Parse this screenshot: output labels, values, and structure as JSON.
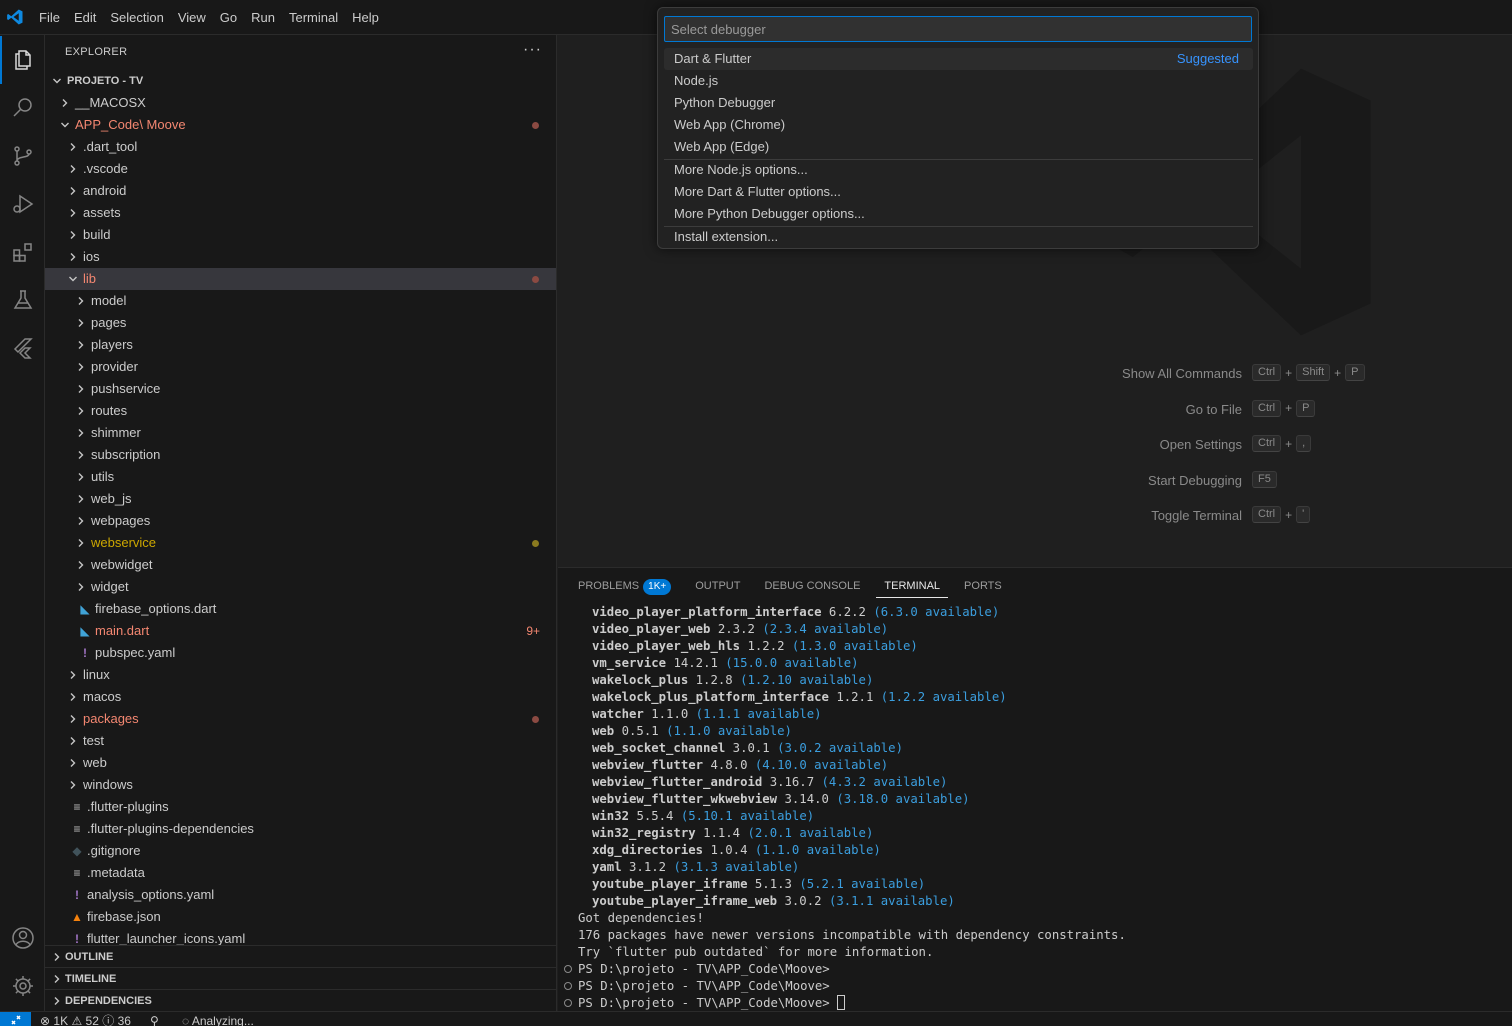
{
  "menubar": [
    "File",
    "Edit",
    "Selection",
    "View",
    "Go",
    "Run",
    "Terminal",
    "Help"
  ],
  "activity": [
    "explorer-icon",
    "search-icon",
    "source-control-icon",
    "run-debug-icon",
    "extensions-icon",
    "testing-icon",
    "flutter-icon",
    "accounts-icon",
    "settings-gear-icon"
  ],
  "sidebar": {
    "title": "EXPLORER",
    "more": "···",
    "tree": [
      {
        "indent": 0,
        "kind": "root",
        "open": true,
        "label": "PROJETO - TV"
      },
      {
        "indent": 1,
        "kind": "folder",
        "open": false,
        "label": "__MACOSX"
      },
      {
        "indent": 1,
        "kind": "folder",
        "open": true,
        "label": "APP_Code\\ Moove",
        "color": "#f48771",
        "dot": "#8b4a42"
      },
      {
        "indent": 2,
        "kind": "folder",
        "open": false,
        "label": ".dart_tool"
      },
      {
        "indent": 2,
        "kind": "folder",
        "open": false,
        "label": ".vscode"
      },
      {
        "indent": 2,
        "kind": "folder",
        "open": false,
        "label": "android"
      },
      {
        "indent": 2,
        "kind": "folder",
        "open": false,
        "label": "assets"
      },
      {
        "indent": 2,
        "kind": "folder",
        "open": false,
        "label": "build"
      },
      {
        "indent": 2,
        "kind": "folder",
        "open": false,
        "label": "ios"
      },
      {
        "indent": 2,
        "kind": "folder",
        "open": true,
        "label": "lib",
        "color": "#f48771",
        "dot": "#8b4a42",
        "selected": true
      },
      {
        "indent": 3,
        "kind": "folder",
        "open": false,
        "label": "model"
      },
      {
        "indent": 3,
        "kind": "folder",
        "open": false,
        "label": "pages"
      },
      {
        "indent": 3,
        "kind": "folder",
        "open": false,
        "label": "players"
      },
      {
        "indent": 3,
        "kind": "folder",
        "open": false,
        "label": "provider"
      },
      {
        "indent": 3,
        "kind": "folder",
        "open": false,
        "label": "pushservice"
      },
      {
        "indent": 3,
        "kind": "folder",
        "open": false,
        "label": "routes"
      },
      {
        "indent": 3,
        "kind": "folder",
        "open": false,
        "label": "shimmer"
      },
      {
        "indent": 3,
        "kind": "folder",
        "open": false,
        "label": "subscription"
      },
      {
        "indent": 3,
        "kind": "folder",
        "open": false,
        "label": "utils"
      },
      {
        "indent": 3,
        "kind": "folder",
        "open": false,
        "label": "web_js"
      },
      {
        "indent": 3,
        "kind": "folder",
        "open": false,
        "label": "webpages"
      },
      {
        "indent": 3,
        "kind": "folder",
        "open": false,
        "label": "webservice",
        "color": "#cca700",
        "dot": "#8a7a1f"
      },
      {
        "indent": 3,
        "kind": "folder",
        "open": false,
        "label": "webwidget"
      },
      {
        "indent": 3,
        "kind": "folder",
        "open": false,
        "label": "widget"
      },
      {
        "indent": 3,
        "kind": "file",
        "icon": "dart-file-icon",
        "glyph": "◣",
        "glyphColor": "#40a3d7",
        "label": "firebase_options.dart"
      },
      {
        "indent": 3,
        "kind": "file",
        "icon": "dart-file-icon",
        "glyph": "◣",
        "glyphColor": "#40a3d7",
        "label": "main.dart",
        "color": "#f48771",
        "badge": "9+"
      },
      {
        "indent": 3,
        "kind": "file",
        "icon": "yaml-file-icon",
        "glyph": "!",
        "glyphColor": "#a074c4",
        "label": "pubspec.yaml"
      },
      {
        "indent": 2,
        "kind": "folder",
        "open": false,
        "label": "linux"
      },
      {
        "indent": 2,
        "kind": "folder",
        "open": false,
        "label": "macos"
      },
      {
        "indent": 2,
        "kind": "folder",
        "open": false,
        "label": "packages",
        "color": "#f48771",
        "dot": "#8b4a42"
      },
      {
        "indent": 2,
        "kind": "folder",
        "open": false,
        "label": "test"
      },
      {
        "indent": 2,
        "kind": "folder",
        "open": false,
        "label": "web"
      },
      {
        "indent": 2,
        "kind": "folder",
        "open": false,
        "label": "windows"
      },
      {
        "indent": 2,
        "kind": "file",
        "icon": "text-file-icon",
        "glyph": "≡",
        "glyphColor": "#bbbbbb",
        "label": ".flutter-plugins"
      },
      {
        "indent": 2,
        "kind": "file",
        "icon": "text-file-icon",
        "glyph": "≡",
        "glyphColor": "#bbbbbb",
        "label": ".flutter-plugins-dependencies"
      },
      {
        "indent": 2,
        "kind": "file",
        "icon": "git-file-icon",
        "glyph": "◆",
        "glyphColor": "#41535b",
        "label": ".gitignore"
      },
      {
        "indent": 2,
        "kind": "file",
        "icon": "text-file-icon",
        "glyph": "≡",
        "glyphColor": "#bbbbbb",
        "label": ".metadata"
      },
      {
        "indent": 2,
        "kind": "file",
        "icon": "yaml-file-icon",
        "glyph": "!",
        "glyphColor": "#a074c4",
        "label": "analysis_options.yaml"
      },
      {
        "indent": 2,
        "kind": "file",
        "icon": "firebase-file-icon",
        "glyph": "▲",
        "glyphColor": "#f5820d",
        "label": "firebase.json"
      },
      {
        "indent": 2,
        "kind": "file",
        "icon": "yaml-file-icon",
        "glyph": "!",
        "glyphColor": "#a074c4",
        "label": "flutter_launcher_icons.yaml"
      }
    ],
    "sections": [
      "OUTLINE",
      "TIMELINE",
      "DEPENDENCIES"
    ]
  },
  "quickpick": {
    "placeholder": "Select debugger",
    "items": [
      {
        "label": "Dart & Flutter",
        "detail": "Suggested",
        "active": true
      },
      {
        "label": "Node.js"
      },
      {
        "label": "Python Debugger"
      },
      {
        "label": "Web App (Chrome)"
      },
      {
        "label": "Web App (Edge)",
        "sepAfter": true
      },
      {
        "label": "More Node.js options..."
      },
      {
        "label": "More Dart & Flutter options..."
      },
      {
        "label": "More Python Debugger options...",
        "sepAfter": true
      },
      {
        "label": "Install extension..."
      }
    ]
  },
  "editor": {
    "shortcuts": [
      {
        "label": "Show All Commands",
        "keys": [
          "Ctrl",
          "Shift",
          "P"
        ]
      },
      {
        "label": "Go to File",
        "keys": [
          "Ctrl",
          "P"
        ]
      },
      {
        "label": "Open Settings",
        "keys": [
          "Ctrl",
          ","
        ]
      },
      {
        "label": "Start Debugging",
        "keys": [
          "F5"
        ]
      },
      {
        "label": "Toggle Terminal",
        "keys": [
          "Ctrl",
          "'"
        ]
      }
    ]
  },
  "panel": {
    "tabs": [
      {
        "label": "PROBLEMS",
        "badge": "1K+"
      },
      {
        "label": "OUTPUT"
      },
      {
        "label": "DEBUG CONSOLE"
      },
      {
        "label": "TERMINAL",
        "active": true
      },
      {
        "label": "PORTS"
      }
    ],
    "terminal": {
      "packages": [
        {
          "name": "video_player_platform_interface",
          "version": "6.2.2",
          "available": "(6.3.0 available)"
        },
        {
          "name": "video_player_web",
          "version": "2.3.2",
          "available": "(2.3.4 available)"
        },
        {
          "name": "video_player_web_hls",
          "version": "1.2.2",
          "available": "(1.3.0 available)"
        },
        {
          "name": "vm_service",
          "version": "14.2.1",
          "available": "(15.0.0 available)"
        },
        {
          "name": "wakelock_plus",
          "version": "1.2.8",
          "available": "(1.2.10 available)"
        },
        {
          "name": "wakelock_plus_platform_interface",
          "version": "1.2.1",
          "available": "(1.2.2 available)"
        },
        {
          "name": "watcher",
          "version": "1.1.0",
          "available": "(1.1.1 available)"
        },
        {
          "name": "web",
          "version": "0.5.1",
          "available": "(1.1.0 available)"
        },
        {
          "name": "web_socket_channel",
          "version": "3.0.1",
          "available": "(3.0.2 available)"
        },
        {
          "name": "webview_flutter",
          "version": "4.8.0",
          "available": "(4.10.0 available)"
        },
        {
          "name": "webview_flutter_android",
          "version": "3.16.7",
          "available": "(4.3.2 available)"
        },
        {
          "name": "webview_flutter_wkwebview",
          "version": "3.14.0",
          "available": "(3.18.0 available)"
        },
        {
          "name": "win32",
          "version": "5.5.4",
          "available": "(5.10.1 available)"
        },
        {
          "name": "win32_registry",
          "version": "1.1.4",
          "available": "(2.0.1 available)"
        },
        {
          "name": "xdg_directories",
          "version": "1.0.4",
          "available": "(1.1.0 available)"
        },
        {
          "name": "yaml",
          "version": "3.1.2",
          "available": "(3.1.3 available)"
        },
        {
          "name": "youtube_player_iframe",
          "version": "5.1.3",
          "available": "(5.2.1 available)"
        },
        {
          "name": "youtube_player_iframe_web",
          "version": "3.0.2",
          "available": "(3.1.1 available)"
        }
      ],
      "messages": [
        "Got dependencies!",
        "176 packages have newer versions incompatible with dependency constraints.",
        "Try `flutter pub outdated` for more information."
      ],
      "prompts": [
        "PS D:\\projeto - TV\\APP_Code\\Moove>",
        "PS D:\\projeto - TV\\APP_Code\\Moove>",
        "PS D:\\projeto - TV\\APP_Code\\Moove> "
      ]
    }
  },
  "statusbar": {
    "errors": "1K",
    "warnings": "52",
    "infos": "36",
    "analyzing": "Analyzing..."
  },
  "colors": {
    "accent": "#0078d4",
    "modified": "#f48771",
    "warning": "#cca700",
    "link": "#3794ff"
  }
}
